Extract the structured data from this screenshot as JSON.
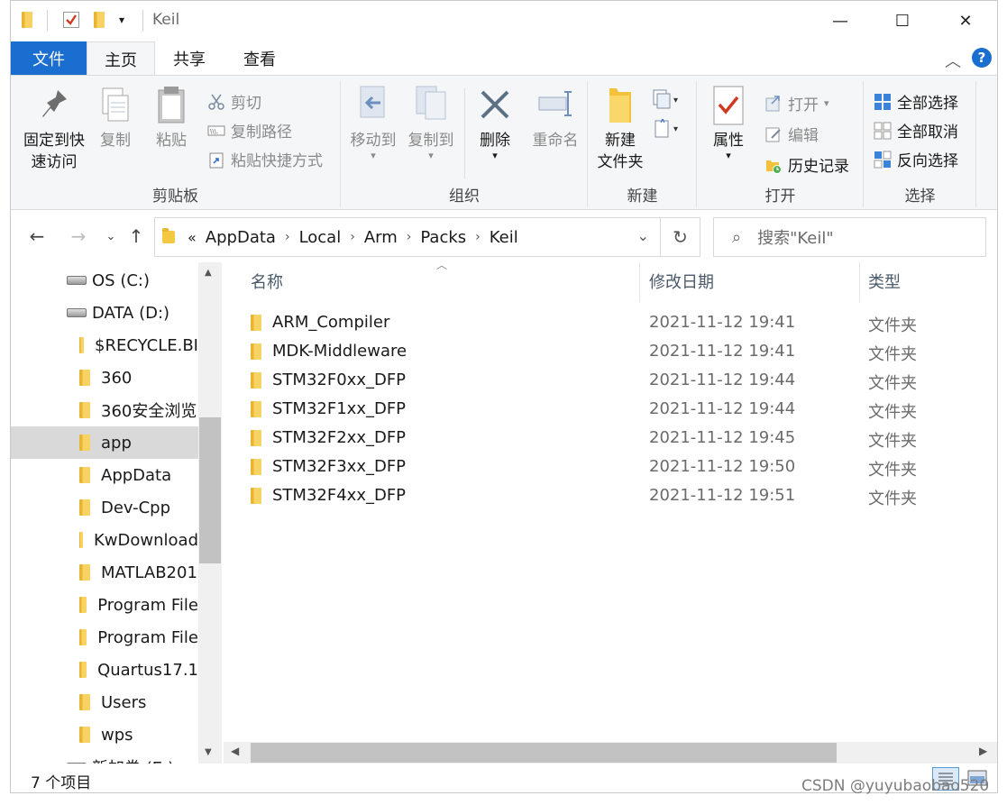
{
  "window": {
    "title": "Keil",
    "controls": {
      "minimize": "—",
      "maximize": "☐",
      "close": "✕"
    }
  },
  "ribbon": {
    "tabs": {
      "file": "文件",
      "home": "主页",
      "share": "共享",
      "view": "查看"
    },
    "clipboard": {
      "label": "剪贴板",
      "pin_line1": "固定到快",
      "pin_line2": "速访问",
      "copy": "复制",
      "paste": "粘贴",
      "cut": "剪切",
      "copy_path": "复制路径",
      "paste_shortcut": "粘贴快捷方式"
    },
    "organize": {
      "label": "组织",
      "move_to": "移动到",
      "copy_to": "复制到",
      "delete": "删除",
      "rename": "重命名"
    },
    "new": {
      "label": "新建",
      "new_folder_line1": "新建",
      "new_folder_line2": "文件夹"
    },
    "open": {
      "label": "打开",
      "properties": "属性",
      "open": "打开",
      "edit": "编辑",
      "history": "历史记录"
    },
    "select": {
      "label": "选择",
      "select_all": "全部选择",
      "select_none": "全部取消",
      "invert": "反向选择"
    }
  },
  "address": {
    "prefix": "«",
    "segments": [
      "AppData",
      "Local",
      "Arm",
      "Packs",
      "Keil"
    ],
    "search_placeholder": "搜索\"Keil\""
  },
  "nav_tree": [
    {
      "label": "OS (C:)",
      "kind": "drive"
    },
    {
      "label": "DATA (D:)",
      "kind": "drive"
    },
    {
      "label": "$RECYCLE.BI",
      "kind": "folder"
    },
    {
      "label": "360",
      "kind": "folder"
    },
    {
      "label": "360安全浏览",
      "kind": "folder"
    },
    {
      "label": "app",
      "kind": "folder",
      "selected": true
    },
    {
      "label": "AppData",
      "kind": "folder"
    },
    {
      "label": "Dev-Cpp",
      "kind": "folder"
    },
    {
      "label": "KwDownload",
      "kind": "folder"
    },
    {
      "label": "MATLAB201",
      "kind": "folder"
    },
    {
      "label": "Program File",
      "kind": "folder"
    },
    {
      "label": "Program File",
      "kind": "folder"
    },
    {
      "label": "Quartus17.1",
      "kind": "folder"
    },
    {
      "label": "Users",
      "kind": "folder"
    },
    {
      "label": "wps",
      "kind": "folder"
    },
    {
      "label": "新加卷 (E:)",
      "kind": "drive"
    }
  ],
  "columns": {
    "name": "名称",
    "date": "修改日期",
    "type": "类型"
  },
  "files": [
    {
      "name": "ARM_Compiler",
      "date": "2021-11-12 19:41",
      "type": "文件夹"
    },
    {
      "name": "MDK-Middleware",
      "date": "2021-11-12 19:41",
      "type": "文件夹"
    },
    {
      "name": "STM32F0xx_DFP",
      "date": "2021-11-12 19:44",
      "type": "文件夹"
    },
    {
      "name": "STM32F1xx_DFP",
      "date": "2021-11-12 19:44",
      "type": "文件夹"
    },
    {
      "name": "STM32F2xx_DFP",
      "date": "2021-11-12 19:45",
      "type": "文件夹"
    },
    {
      "name": "STM32F3xx_DFP",
      "date": "2021-11-12 19:50",
      "type": "文件夹"
    },
    {
      "name": "STM32F4xx_DFP",
      "date": "2021-11-12 19:51",
      "type": "文件夹"
    }
  ],
  "status": {
    "count": "7 个项目"
  },
  "watermark": "CSDN @yuyubaobao520",
  "colors": {
    "accent": "#1a6ed0",
    "folder": "#f5c842",
    "selected": "#d9d9d9"
  }
}
